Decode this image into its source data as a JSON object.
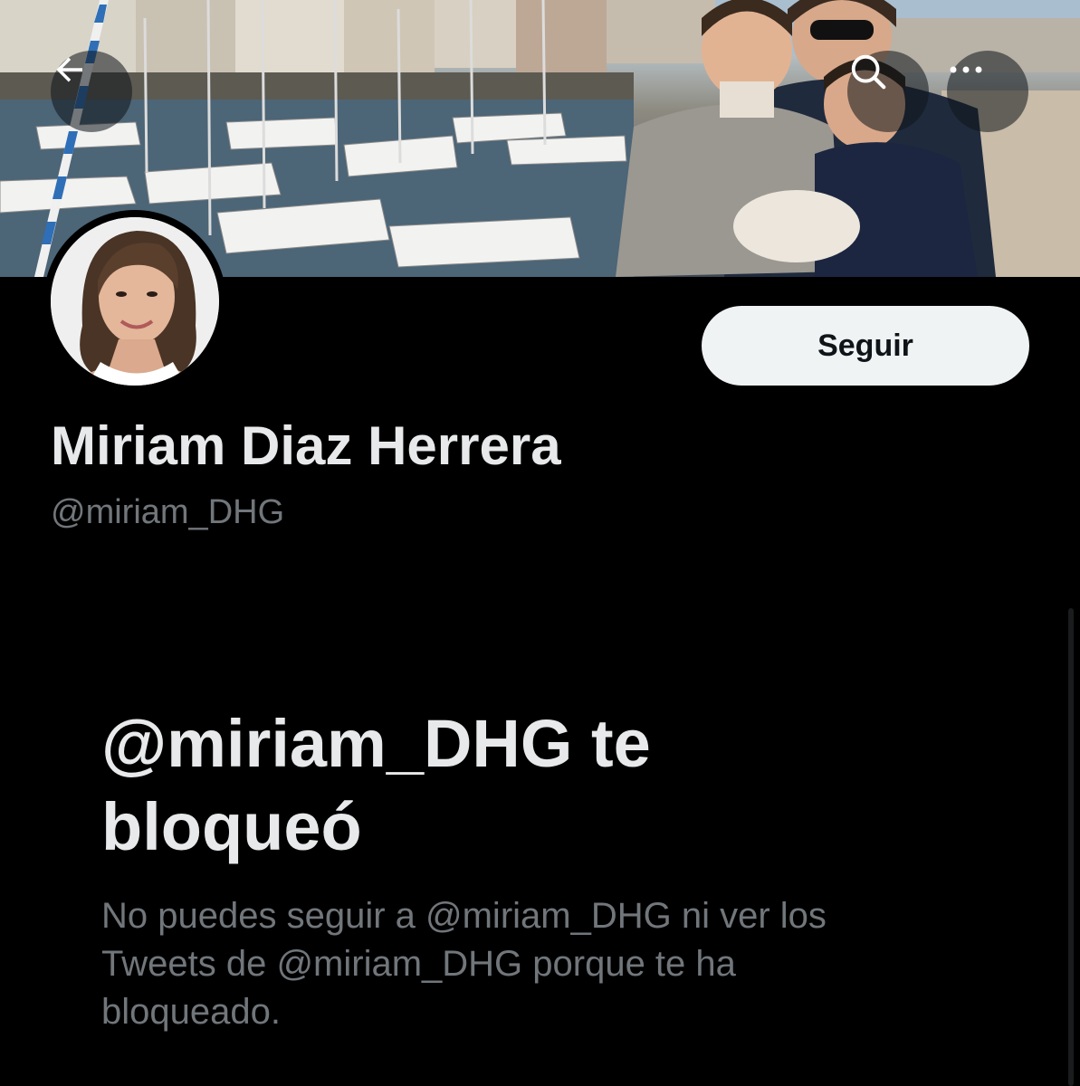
{
  "header": {
    "back_icon": "arrow-left-icon",
    "search_icon": "search-icon",
    "more_icon": "more-horizontal-icon"
  },
  "profile": {
    "display_name": "Miriam Diaz Herrera",
    "handle": "@miriam_DHG",
    "follow_label": "Seguir"
  },
  "blocked": {
    "title": "@miriam_DHG te bloqueó",
    "description": "No puedes seguir a @miriam_DHG ni ver los Tweets de @miriam_DHG porque te ha bloqueado."
  },
  "colors": {
    "background": "#000000",
    "primary_text": "#e7e9ea",
    "secondary_text": "#71767b",
    "follow_button_bg": "#eff3f4",
    "follow_button_text": "#0f1419"
  }
}
